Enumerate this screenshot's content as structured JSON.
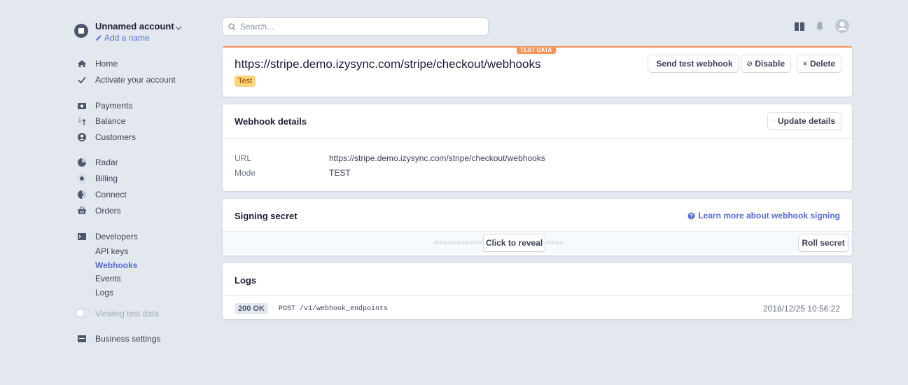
{
  "account": {
    "name": "Unnamed account",
    "add_name": "Add a name"
  },
  "search": {
    "placeholder": "Search..."
  },
  "sidebar": {
    "items": [
      {
        "label": "Home",
        "icon": "home-icon"
      },
      {
        "label": "Activate your account",
        "icon": "check-icon"
      },
      {
        "label": "Payments",
        "icon": "payments-icon"
      },
      {
        "label": "Balance",
        "icon": "balance-icon"
      },
      {
        "label": "Customers",
        "icon": "customers-icon"
      },
      {
        "label": "Radar",
        "icon": "radar-icon"
      },
      {
        "label": "Billing",
        "icon": "billing-icon"
      },
      {
        "label": "Connect",
        "icon": "connect-icon"
      },
      {
        "label": "Orders",
        "icon": "orders-icon"
      },
      {
        "label": "Developers",
        "icon": "developers-icon"
      },
      {
        "label": "Business settings",
        "icon": "business-settings-icon"
      }
    ],
    "developer_sub": [
      "API keys",
      "Webhooks",
      "Events",
      "Logs"
    ],
    "active_sub": "Webhooks",
    "test_toggle_label": "Viewing test data"
  },
  "endpoint": {
    "test_data_tag": "TEST DATA",
    "url": "https://stripe.demo.izysync.com/stripe/checkout/webhooks",
    "mode_badge": "Test",
    "send_test_label": "Send test webhook",
    "disable_label": "Disable",
    "delete_label": "Delete"
  },
  "details": {
    "title": "Webhook details",
    "update_label": "Update details",
    "url_key": "URL",
    "url_value": "https://stripe.demo.izysync.com/stripe/checkout/webhooks",
    "mode_key": "Mode",
    "mode_value": "TEST"
  },
  "signing": {
    "title": "Signing secret",
    "learn_more": "Learn more about webhook signing",
    "reveal_label": "Click to reveal",
    "roll_label": "Roll secret"
  },
  "logs": {
    "title": "Logs",
    "entries": [
      {
        "status": "200 OK",
        "request": "POST /v1/webhook_endpoints",
        "time": "2018/12/25 10:56:22"
      }
    ]
  },
  "colors": {
    "background": "#e3e8ee",
    "accent": "#556cd6",
    "test_orange": "#f5955a",
    "test_badge_bg": "#fcd579"
  }
}
